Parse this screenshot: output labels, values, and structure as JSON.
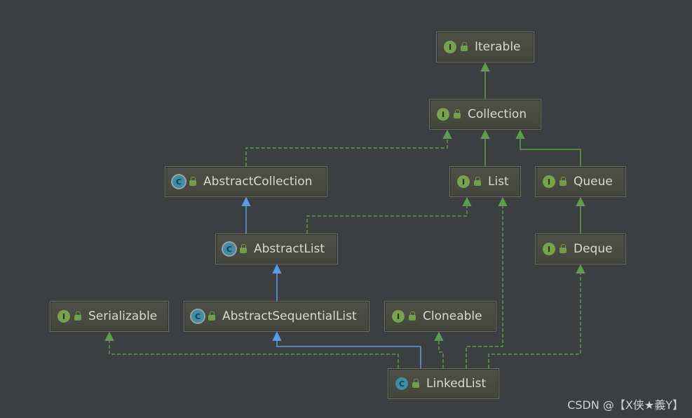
{
  "nodes": [
    {
      "id": "iterable",
      "label": "Iterable",
      "kind": "I"
    },
    {
      "id": "collection",
      "label": "Collection",
      "kind": "I"
    },
    {
      "id": "abstractcollection",
      "label": "AbstractCollection",
      "kind": "C"
    },
    {
      "id": "list",
      "label": "List",
      "kind": "I"
    },
    {
      "id": "queue",
      "label": "Queue",
      "kind": "I"
    },
    {
      "id": "abstractlist",
      "label": "AbstractList",
      "kind": "C"
    },
    {
      "id": "deque",
      "label": "Deque",
      "kind": "I"
    },
    {
      "id": "serializable",
      "label": "Serializable",
      "kind": "I"
    },
    {
      "id": "abstractsequentiallist",
      "label": "AbstractSequentialList",
      "kind": "C"
    },
    {
      "id": "cloneable",
      "label": "Cloneable",
      "kind": "I"
    },
    {
      "id": "linkedlist",
      "label": "LinkedList",
      "kind": "C"
    }
  ],
  "edges": [
    {
      "from": "collection",
      "to": "iterable",
      "type": "extends-interface"
    },
    {
      "from": "abstractcollection",
      "to": "collection",
      "type": "implements"
    },
    {
      "from": "list",
      "to": "collection",
      "type": "extends-interface"
    },
    {
      "from": "queue",
      "to": "collection",
      "type": "extends-interface"
    },
    {
      "from": "abstractlist",
      "to": "abstractcollection",
      "type": "extends-class"
    },
    {
      "from": "abstractlist",
      "to": "list",
      "type": "implements"
    },
    {
      "from": "deque",
      "to": "queue",
      "type": "extends-interface"
    },
    {
      "from": "abstractsequentiallist",
      "to": "abstractlist",
      "type": "extends-class"
    },
    {
      "from": "linkedlist",
      "to": "abstractsequentiallist",
      "type": "extends-class"
    },
    {
      "from": "linkedlist",
      "to": "serializable",
      "type": "implements"
    },
    {
      "from": "linkedlist",
      "to": "cloneable",
      "type": "implements"
    },
    {
      "from": "linkedlist",
      "to": "list",
      "type": "implements"
    },
    {
      "from": "linkedlist",
      "to": "deque",
      "type": "implements"
    }
  ],
  "colors": {
    "background": "#3c3f41",
    "interface_edge": "#5c9e4e",
    "class_edge": "#5b9be6"
  },
  "watermark": "CSDN @【X侠★義Y】"
}
